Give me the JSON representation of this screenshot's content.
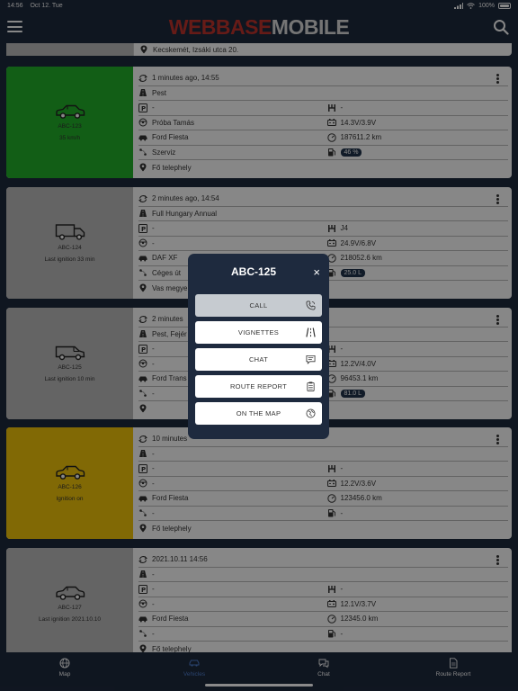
{
  "status": {
    "time": "14:56",
    "date": "Oct 12. Tue",
    "battery": "100%"
  },
  "header": {
    "logo_a": "WEBBASE",
    "logo_b": "MOBILE"
  },
  "prev": {
    "address": "Kecskemét, Izsáki utca 20."
  },
  "cards": [
    {
      "color": "#22b12a",
      "vehicle": "car",
      "plate": "ABC-123",
      "sub": "35 km/h",
      "time": "1 minutes ago, 14:55",
      "r1": "Pest",
      "r2a": "-",
      "r2b": "-",
      "r3a": "Próba Tamás",
      "r3b": "14.3V/3.9V",
      "r4a": "Ford Fiesta",
      "r4b": "187611.2 km",
      "r5a": "Szerviz",
      "r5b": "46 %",
      "r6": "Fő telephely"
    },
    {
      "color": "#bdbdbd",
      "vehicle": "truck",
      "plate": "ABC-124",
      "sub": "Last ignition 33 min",
      "time": "2 minutes ago, 14:54",
      "r1": "Full Hungary Annual",
      "r2a": "-",
      "r2b": "J4",
      "r3a": "-",
      "r3b": "24.9V/6.8V",
      "r4a": "DAF XF",
      "r4b": "218052.6 km",
      "r5a": "Céges út",
      "r5b": "25.0 L",
      "r6": "Vas megye"
    },
    {
      "color": "#bdbdbd",
      "vehicle": "van",
      "plate": "ABC-125",
      "sub": "Last ignition 10 min",
      "time": "2 minutes",
      "r1": "Pest, Fejér",
      "r2a": "-",
      "r2b": "-",
      "r3a": "-",
      "r3b": "12.2V/4.0V",
      "r4a": "Ford Trans",
      "r4b": "96453.1 km",
      "r5a": "-",
      "r5b": "81.0 L",
      "r6": ""
    },
    {
      "color": "#f4c60a",
      "vehicle": "car",
      "plate": "ABC-126",
      "sub": "Ignition on",
      "time": "10 minutes",
      "r1": "-",
      "r2a": "-",
      "r2b": "-",
      "r3a": "-",
      "r3b": "12.2V/3.6V",
      "r4a": "Ford Fiesta",
      "r4b": "123456.0 km",
      "r5a": "-",
      "r5b": "-",
      "r6": "Fő telephely"
    },
    {
      "color": "#bdbdbd",
      "vehicle": "car",
      "plate": "ABC-127",
      "sub": "Last ignition 2021.10.10",
      "time": "2021.10.11 14:56",
      "r1": "-",
      "r2a": "-",
      "r2b": "-",
      "r3a": "-",
      "r3b": "12.1V/3.7V",
      "r4a": "Ford Fiesta",
      "r4b": "12345.0 km",
      "r5a": "-",
      "r5b": "-",
      "r6": "Fő telephely"
    }
  ],
  "modal": {
    "title": "ABC-125",
    "close": "×",
    "call": "CALL",
    "vignettes": "VIGNETTES",
    "chat": "CHAT",
    "route_report": "ROUTE REPORT",
    "on_the_map": "ON THE MAP"
  },
  "tabs": {
    "map": "Map",
    "vehicles": "Vehicles",
    "chat": "Chat",
    "route_report": "Route Report"
  }
}
